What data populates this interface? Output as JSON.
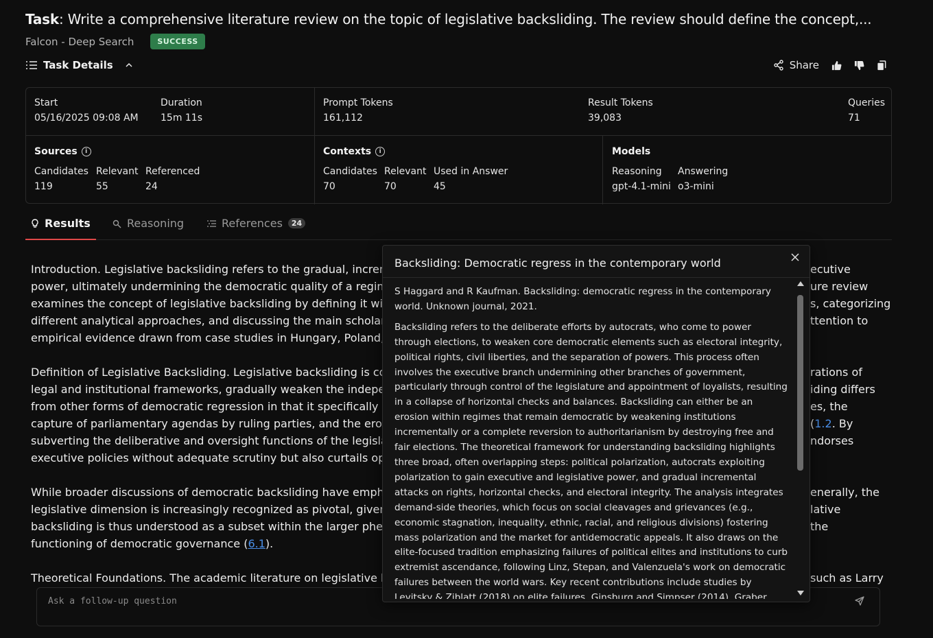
{
  "task": {
    "prefix": "Task",
    "text": "Write a comprehensive literature review on the topic of legislative backsliding. The review should define the concept,...",
    "agent": "Falcon - Deep Search",
    "status": "SUCCESS"
  },
  "details_toggle": {
    "label": "Task Details"
  },
  "actions": {
    "share": "Share"
  },
  "stats": {
    "start": {
      "label": "Start",
      "value": "05/16/2025 09:08 AM"
    },
    "duration": {
      "label": "Duration",
      "value": "15m 11s"
    },
    "prompt_tokens": {
      "label": "Prompt Tokens",
      "value": "161,112"
    },
    "result_tokens": {
      "label": "Result Tokens",
      "value": "39,083"
    },
    "queries": {
      "label": "Queries",
      "value": "71"
    },
    "sources": {
      "title": "Sources",
      "candidates": {
        "label": "Candidates",
        "value": "119"
      },
      "relevant": {
        "label": "Relevant",
        "value": "55"
      },
      "referenced": {
        "label": "Referenced",
        "value": "24"
      }
    },
    "contexts": {
      "title": "Contexts",
      "candidates": {
        "label": "Candidates",
        "value": "70"
      },
      "relevant": {
        "label": "Relevant",
        "value": "70"
      },
      "used": {
        "label": "Used in Answer",
        "value": "45"
      }
    },
    "models": {
      "title": "Models",
      "reasoning": {
        "label": "Reasoning",
        "value": "gpt-4.1-mini"
      },
      "answering": {
        "label": "Answering",
        "value": "o3-mini"
      }
    }
  },
  "tabs": [
    {
      "label": "Results",
      "active": true
    },
    {
      "label": "Reasoning",
      "active": false
    },
    {
      "label": "References",
      "active": false,
      "count": "24"
    }
  ],
  "results": {
    "p1": [
      "Introduction. Legislative backsliding refers to the gradual, increme",
      "power, ultimately undermining the democratic quality of a regime w",
      "examines the concept of legislative backsliding by defining it withi",
      "different analytical approaches, and discussing the main scholarly",
      "empirical evidence drawn from case studies in Hungary, Poland, ar"
    ],
    "p1_right": [
      "ecutive",
      "ure review",
      "s, categorizing",
      "ttention to",
      ""
    ],
    "p2": [
      "Definition of Legislative Backsliding. Legislative backsliding is conc",
      "legal and institutional frameworks, gradually weaken the independ",
      "from other forms of democratic regression in that it specifically ex",
      "capture of parliamentary agendas by ruling parties, and the erodin",
      "subverting the deliberative and oversight functions of the legislatu",
      "executive policies without adequate scrutiny but also curtails oppo"
    ],
    "p2_right": [
      "rations of",
      "iding differs",
      "es, the",
      "",
      "ndorses",
      ""
    ],
    "p2_link": "1.2",
    "p2_link_after": ". By",
    "p3": [
      "While broader discussions of democratic backsliding have emphas",
      "legislative dimension is increasingly recognized as pivotal, given it",
      "backsliding is thus understood as a subset within the larger pheno",
      "functioning of democratic governance ("
    ],
    "p3_right": [
      "enerally, the",
      "lative",
      "the",
      ""
    ],
    "p3_link": "6.1",
    "p3_link_after": ").",
    "p4": "Theoretical Foundations. The academic literature on legislative bac",
    "p4_right": "such as Larry"
  },
  "followup": {
    "placeholder": "Ask a follow-up question"
  },
  "popup": {
    "title": "Backsliding: Democratic regress in the contemporary world",
    "citation": "S Haggard and R Kaufman. Backsliding: democratic regress in the contemporary world. Unknown journal, 2021.",
    "abstract": "Backsliding refers to the deliberate efforts by autocrats, who come to power through elections, to weaken core democratic elements such as electoral integrity, political rights, civil liberties, and the separation of powers. This process often involves the executive branch undermining other branches of government, particularly through control of the legislature and appointment of loyalists, resulting in a collapse of horizontal checks and balances. Backsliding can either be an erosion within regimes that remain democratic by weakening institutions incrementally or a complete reversion to authoritarianism by destroying free and fair elections. The theoretical framework for understanding backsliding highlights three broad, often overlapping steps: political polarization, autocrats exploiting polarization to gain executive and legislative power, and gradual incremental attacks on rights, horizontal checks, and electoral integrity. The analysis integrates demand-side theories, which focus on social cleavages and grievances (e.g., economic stagnation, inequality, ethnic, racial, and religious divisions) fostering mass polarization and the market for antidemocratic appeals. It also draws on the elite-focused tradition emphasizing failures of political elites and institutions to curb extremist ascendance, following Linz, Stepan, and Valenzuela's work on democratic failures between the world wars. Key recent contributions include studies by Levitsky & Ziblatt (2018) on elite failures, Ginsburg and Simpser (2014), Graber,"
  },
  "colors": {
    "accent": "#e04848",
    "success": "#2e7d4a",
    "link": "#4a8fe8"
  }
}
